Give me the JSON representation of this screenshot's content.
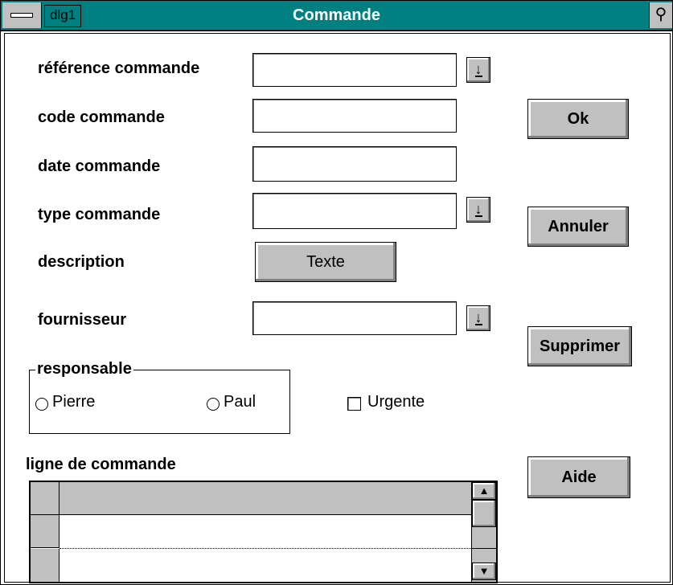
{
  "window": {
    "dialog_name": "dlg1",
    "title": "Commande",
    "sysmenu_icon": "minus-bar-icon",
    "corner_icon": "gear-icon",
    "corner_glyph": "⚲"
  },
  "form": {
    "reference_label": "référence commande",
    "reference_value": "",
    "code_label": "code commande",
    "code_value": "",
    "date_label": "date commande",
    "date_value": "",
    "type_label": "type commande",
    "type_value": "",
    "description_label": "description",
    "description_button": "Texte",
    "fournisseur_label": "fournisseur",
    "fournisseur_value": "",
    "dropdown_glyph": "↓"
  },
  "responsable": {
    "title": "responsable",
    "options": [
      {
        "label": "Pierre",
        "selected": false
      },
      {
        "label": "Paul",
        "selected": false
      }
    ]
  },
  "urgente": {
    "label": "Urgente",
    "checked": false
  },
  "lines": {
    "label": "ligne de commande",
    "scroll_up_glyph": "▲",
    "scroll_down_glyph": "▼"
  },
  "buttons": {
    "ok": "Ok",
    "annuler": "Annuler",
    "supprimer": "Supprimer",
    "aide": "Aide"
  },
  "colors": {
    "titlebar": "#008080",
    "button_face": "#c0c0c0"
  }
}
